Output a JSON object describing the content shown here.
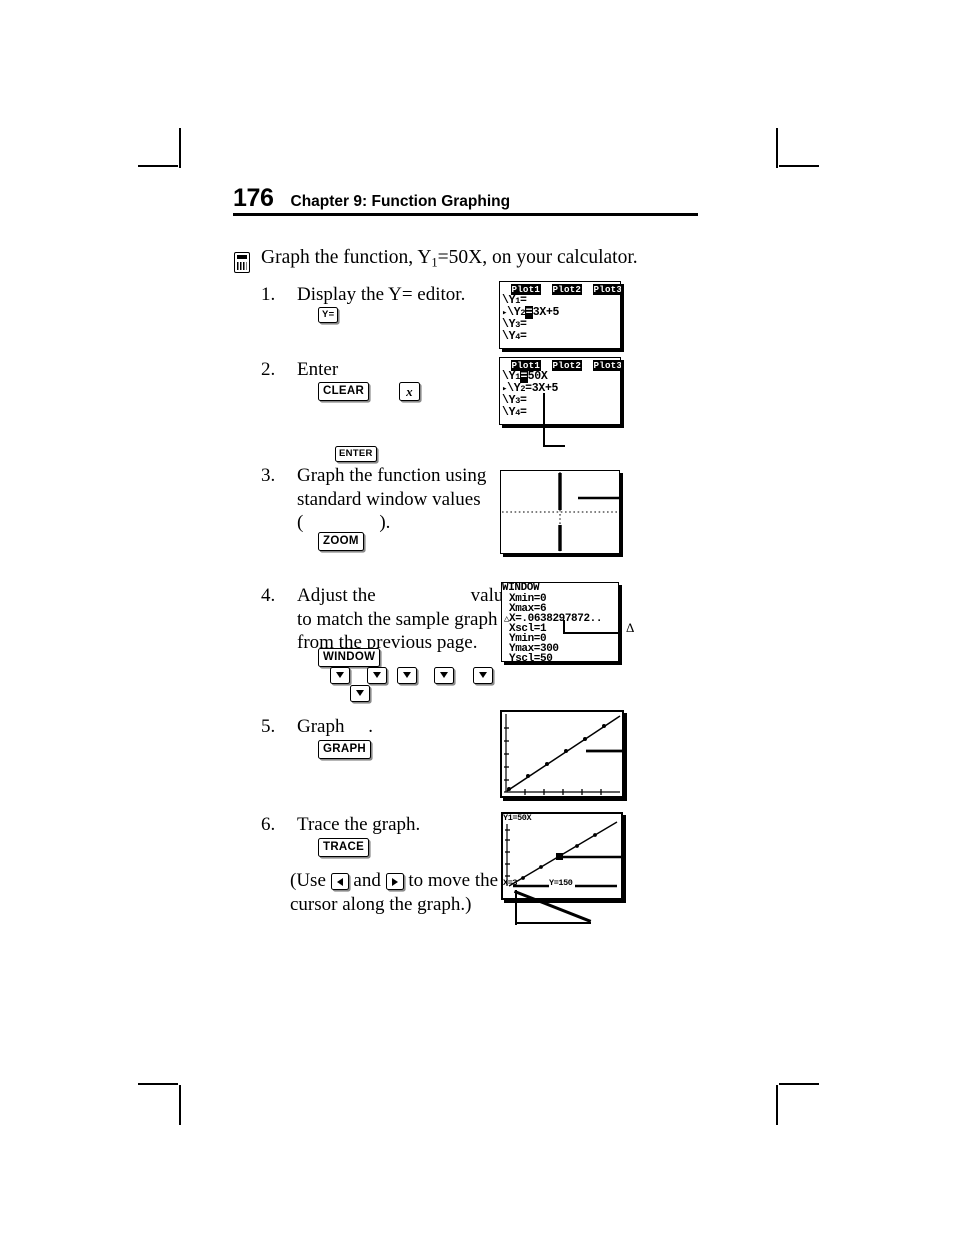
{
  "header": {
    "folio": "176",
    "title": "Chapter 9: Function Graphing"
  },
  "intro": {
    "text_before": "Graph the function, Y",
    "subscript": "1",
    "text_after": "=50X, on your calculator.",
    "icon": "calculator-icon"
  },
  "steps": [
    {
      "number": "1.",
      "text": "Display the Y= editor.",
      "keys": [
        "Y="
      ]
    },
    {
      "number": "2.",
      "text": "Enter",
      "keys": [
        "CLEAR",
        "x"
      ],
      "extra_key": "ENTER"
    },
    {
      "number": "3.",
      "text_line1": "Graph the function using",
      "text_line2": "standard window values",
      "text_line3": "(                ).",
      "keys": [
        "ZOOM"
      ]
    },
    {
      "number": "4.",
      "text_line1": "Adjust the                    values",
      "text_line2": "to match the sample graph",
      "text_line3": "from the previous page.",
      "keys": [
        "WINDOW"
      ],
      "arrow_keys_row1": [
        "down",
        "down",
        "down",
        "down",
        "down"
      ],
      "arrow_keys_row2": [
        "down"
      ]
    },
    {
      "number": "5.",
      "text": "Graph     .",
      "keys": [
        "GRAPH"
      ]
    },
    {
      "number": "6.",
      "text": "Trace the graph.",
      "keys": [
        "TRACE"
      ],
      "note_line1_before": "(Use ",
      "note_line1_mid": " and ",
      "note_line1_after": " to move the",
      "note_line2": "cursor along the graph.)"
    }
  ],
  "screens": {
    "yeditor_before": {
      "name": "y-editor-screen-before",
      "plot_tabs": [
        "Plot1",
        "Plot2",
        "Plot3"
      ],
      "lines": [
        {
          "label": "\\Y",
          "sub": "1",
          "eq": "=",
          "expr": "",
          "selected": false
        },
        {
          "label": "\\Y",
          "sub": "2",
          "eq": "=",
          "expr": "3X+5",
          "selected": true
        },
        {
          "label": "\\Y",
          "sub": "3",
          "eq": "=",
          "expr": "",
          "selected": false
        },
        {
          "label": "\\Y",
          "sub": "4",
          "eq": "=",
          "expr": "",
          "selected": false
        }
      ]
    },
    "yeditor_after": {
      "name": "y-editor-screen-after",
      "plot_tabs": [
        "Plot1",
        "Plot2",
        "Plot3"
      ],
      "lines": [
        {
          "label": "\\Y",
          "sub": "1",
          "eq": "=",
          "expr": "50X",
          "selected": true
        },
        {
          "label": "\\Y",
          "sub": "2",
          "eq": "=",
          "expr": "3X+5",
          "selected": false
        },
        {
          "label": "\\Y",
          "sub": "3",
          "eq": "=",
          "expr": "",
          "selected": false
        },
        {
          "label": "\\Y",
          "sub": "4",
          "eq": "=",
          "expr": "",
          "selected": false
        }
      ]
    },
    "standard_graph": {
      "name": "standard-window-graph-screen",
      "description": "axes with tick marks and steep line"
    },
    "window_editor": {
      "name": "window-editor-screen",
      "title": "WINDOW",
      "rows": [
        "Xmin=0",
        "Xmax=6",
        "X=.0638297872..",
        "Xscl=1",
        "Ymin=0",
        "Ymax=300",
        "Yscl=50"
      ],
      "delta_prefix": "△",
      "callout_symbol": "Δ"
    },
    "adjusted_graph": {
      "name": "adjusted-window-graph-screen",
      "description": "diagonal line across plot area"
    },
    "trace_graph": {
      "name": "trace-graph-screen",
      "top_label": "Y1=50X",
      "x_label": "X=3",
      "y_label": "Y=150"
    }
  }
}
